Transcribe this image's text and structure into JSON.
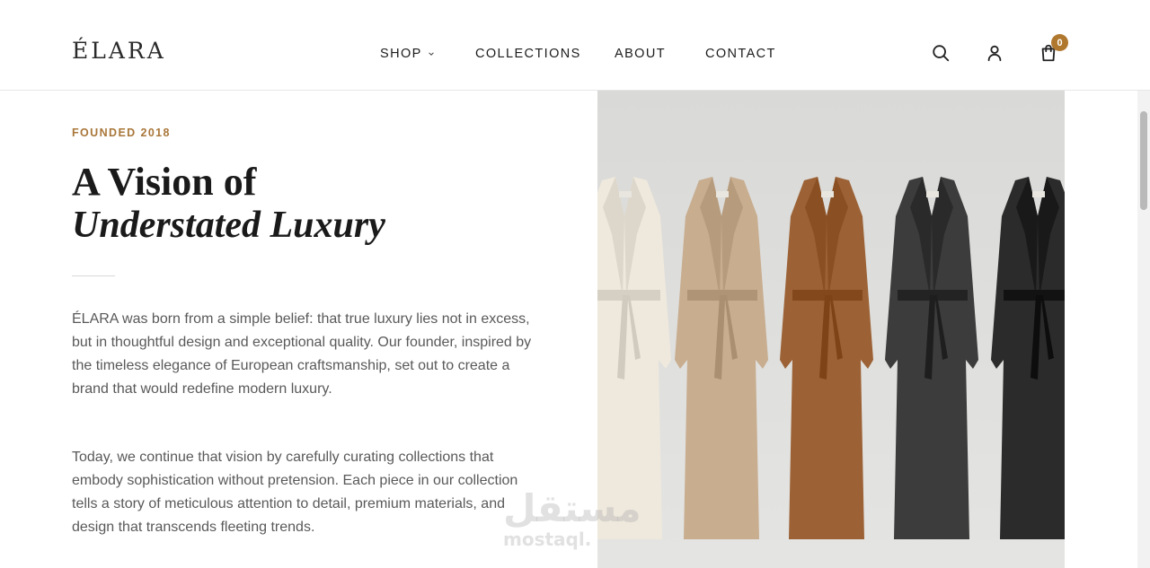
{
  "header": {
    "logo": "ÉLARA",
    "nav": [
      {
        "label": "SHOP",
        "has_dropdown": true
      },
      {
        "label": "COLLECTIONS"
      },
      {
        "label": "ABOUT"
      },
      {
        "label": "CONTACT"
      }
    ],
    "icons": [
      "search-icon",
      "user-icon",
      "cart-icon"
    ],
    "cart_count": "0"
  },
  "hero": {
    "eyebrow": "FOUNDED 2018",
    "heading_line1": "A Vision of",
    "heading_line2": "Understated Luxury",
    "paragraph1": "ÉLARA was born from a simple belief: that true luxury lies not in excess, but in thoughtful design and exceptional quality. Our founder, inspired by the timeless elegance of European craftsmanship, set out to create a brand that would redefine modern luxury.",
    "paragraph2": "Today, we continue that vision by carefully curating collections that embody sophistication without pretension. Each piece in our collection tells a story of meticulous attention to detail, premium materials, and design that transcends fleeting trends."
  },
  "image": {
    "subject": "five long belted coats on hangers",
    "coat_colors": [
      "#efe9dd",
      "#c8ad8f",
      "#9c6236",
      "#3c3c3c",
      "#2b2b2b"
    ],
    "background": "#dcdcda"
  },
  "watermark": {
    "arabic": "مستقل",
    "latin": "mostaql."
  },
  "colors": {
    "accent": "#b0782f",
    "text": "#595959",
    "heading": "#1a1a1a"
  }
}
